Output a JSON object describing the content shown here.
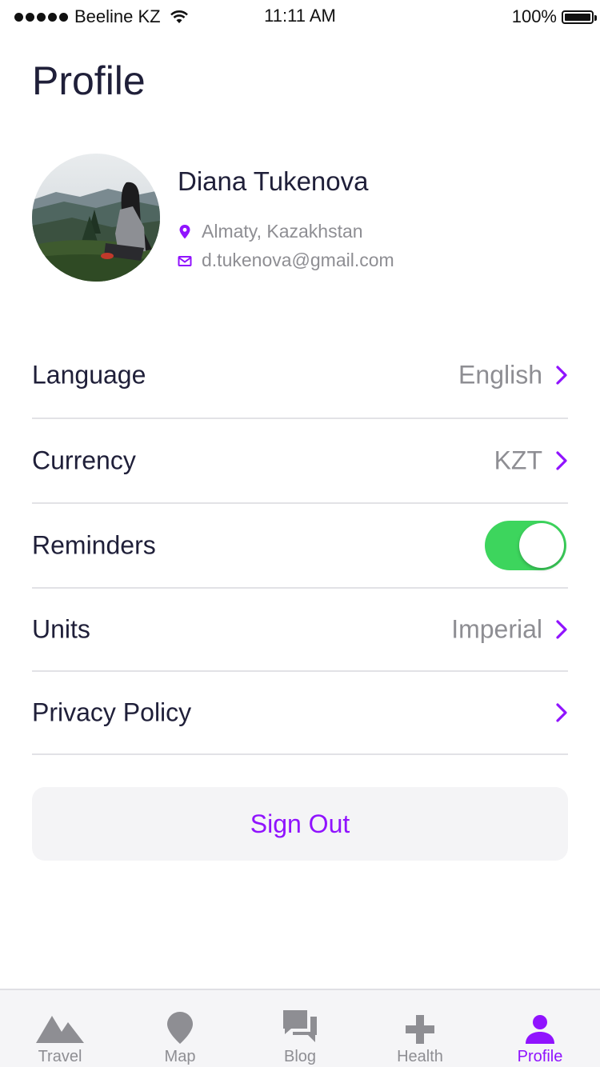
{
  "status_bar": {
    "carrier": "Beeline KZ",
    "time": "11:11 AM",
    "battery": "100%"
  },
  "header": {
    "title": "Profile"
  },
  "profile": {
    "name": "Diana Tukenova",
    "location": "Almaty, Kazakhstan",
    "email": "d.tukenova@gmail.com"
  },
  "settings": {
    "language": {
      "label": "Language",
      "value": "English"
    },
    "currency": {
      "label": "Currency",
      "value": "KZT"
    },
    "reminders": {
      "label": "Reminders",
      "enabled": true
    },
    "units": {
      "label": "Units",
      "value": "Imperial"
    },
    "privacy": {
      "label": "Privacy Policy"
    }
  },
  "actions": {
    "sign_out": "Sign Out"
  },
  "tab_bar": {
    "tabs": [
      {
        "label": "Travel",
        "icon": "mountain-icon"
      },
      {
        "label": "Map",
        "icon": "map-pin-icon"
      },
      {
        "label": "Blog",
        "icon": "chat-bubbles-icon"
      },
      {
        "label": "Health",
        "icon": "plus-icon"
      },
      {
        "label": "Profile",
        "icon": "person-icon"
      }
    ],
    "active": "Profile"
  },
  "colors": {
    "accent": "#9013fe",
    "toggle_on": "#3dd55d",
    "text_primary": "#1f1f39",
    "text_secondary": "#8e8e93"
  }
}
